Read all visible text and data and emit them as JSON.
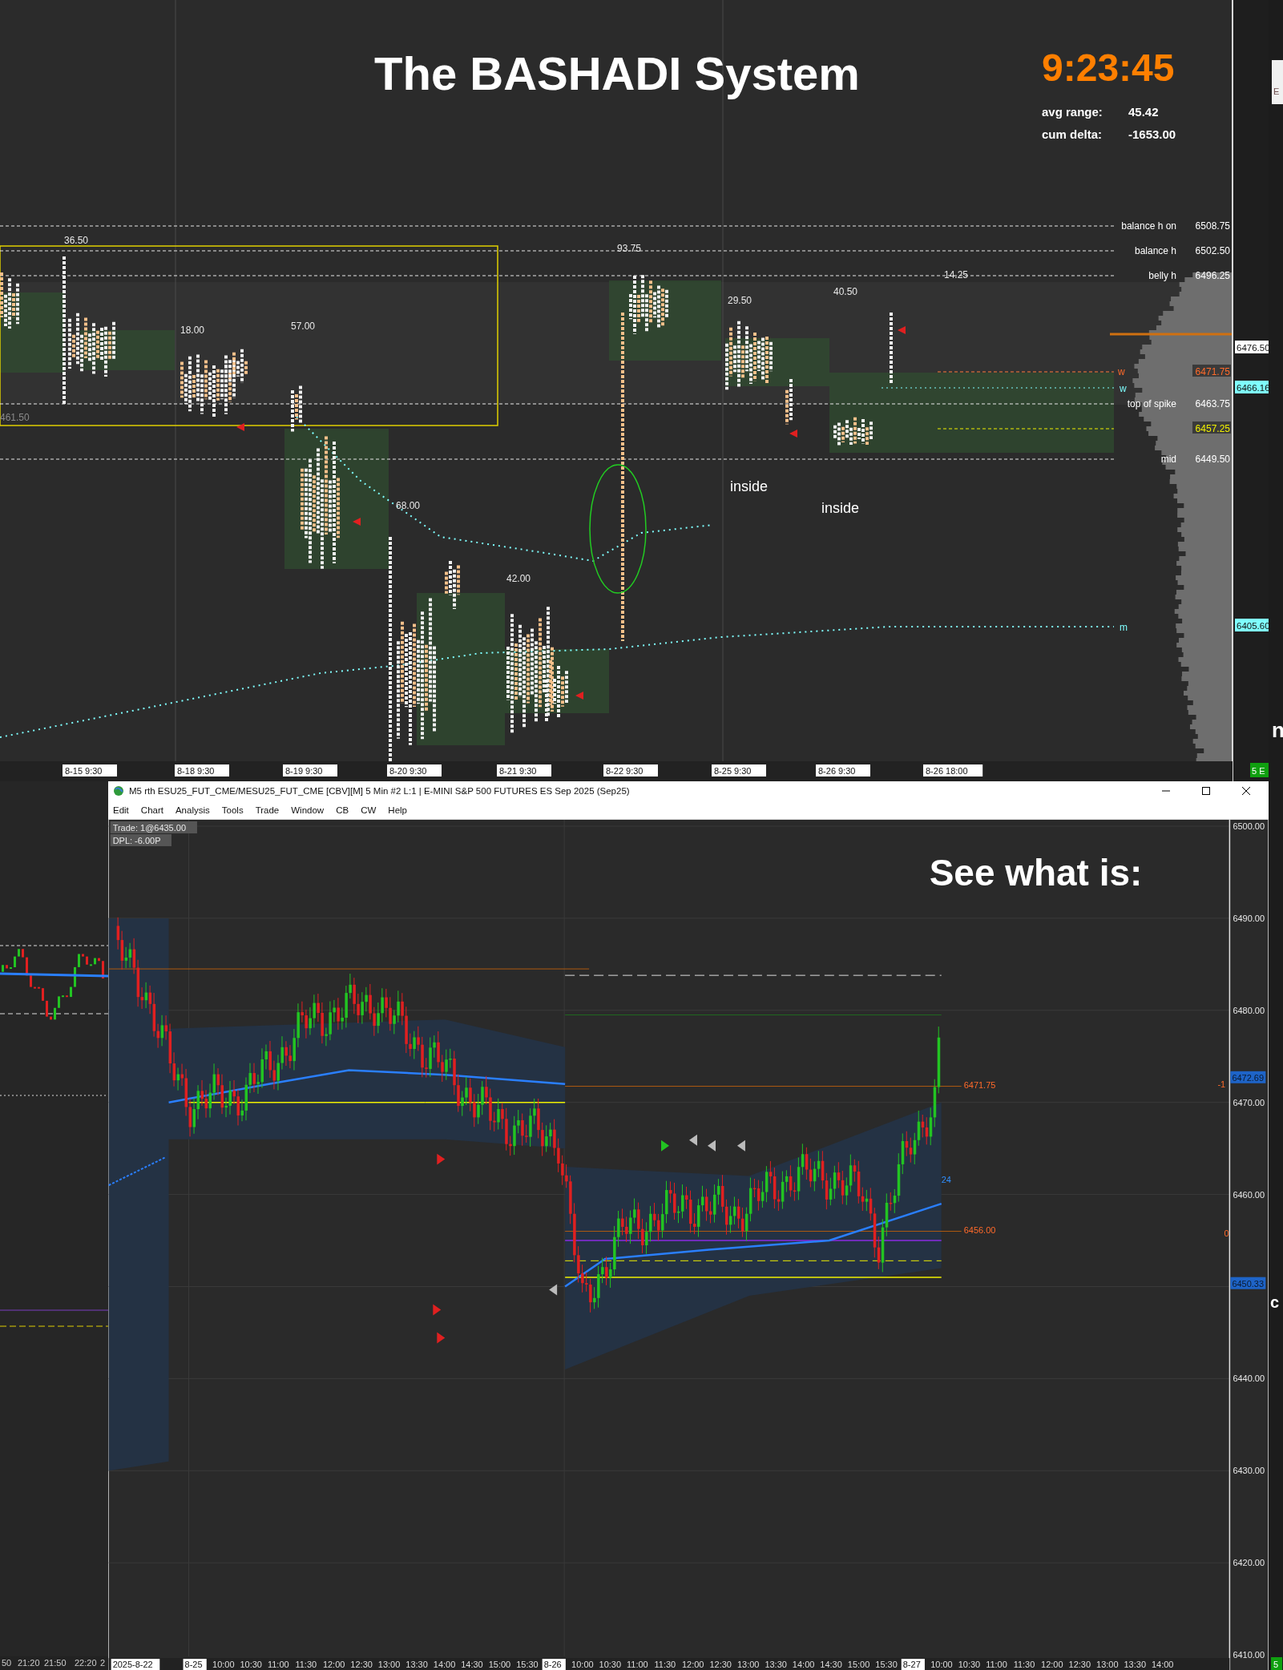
{
  "top_chart": {
    "title": "The BASHADI System",
    "clock": "9:23:45",
    "stats": [
      {
        "label": "avg range:",
        "value": "45.42"
      },
      {
        "label": "cum delta:",
        "value": "-1653.00"
      }
    ],
    "levels": [
      {
        "label": "balance h on",
        "value": "6508.75",
        "kind": "plain"
      },
      {
        "label": "balance h",
        "value": "6502.50",
        "kind": "plain"
      },
      {
        "label": "belly h",
        "value": "6496.25",
        "kind": "plain"
      },
      {
        "value": "6471.75",
        "kind": "orange"
      },
      {
        "label": "top of spike",
        "value": "6463.75",
        "kind": "plain"
      },
      {
        "value": "6457.25",
        "kind": "yellow"
      },
      {
        "label": "mid",
        "value": "6449.50",
        "kind": "plain"
      }
    ],
    "line_markers": [
      {
        "text": "w",
        "kind": "orange"
      },
      {
        "text": "w",
        "kind": "cyan"
      },
      {
        "text": "m",
        "kind": "cyan"
      }
    ],
    "axis_tags": [
      {
        "text": "6476.50",
        "kind": "white"
      },
      {
        "text": "6466.16",
        "kind": "cyan"
      },
      {
        "text": "6405.60",
        "kind": "cyan"
      }
    ],
    "range_labels": [
      "36.50",
      "18.00",
      "57.00",
      "93.75",
      "29.50",
      "40.50",
      "14.25",
      "68.00",
      "42.00",
      "461.50"
    ],
    "notes": [
      "inside",
      "inside"
    ],
    "time_axis": [
      "8-15  9:30",
      "8-18  9:30",
      "8-19  9:30",
      "8-20  9:30",
      "8-21  9:30",
      "8-22  9:30",
      "8-25  9:30",
      "8-26  9:30",
      "8-26  18:00"
    ],
    "badge": "5 E"
  },
  "left_chart": {
    "time_axis": [
      "50",
      "21:20",
      "21:50",
      "22:20",
      "2"
    ]
  },
  "chart_window": {
    "title": "M5 rth ESU25_FUT_CME/MESU25_FUT_CME [CBV][M]  5 Min  #2 L:1 | E-MINI S&P 500 FUTURES ES Sep 2025 (Sep25)",
    "menu": [
      "Edit",
      "Chart",
      "Analysis",
      "Tools",
      "Trade",
      "Window",
      "CB",
      "CW",
      "Help"
    ],
    "info": [
      "Trade: 1@6435.00",
      "DPL: -6.00P"
    ],
    "headline": "See what is:",
    "price_axis": [
      "6500.00",
      "6490.00",
      "6480.00",
      "6470.00",
      "6460.00",
      "6440.00",
      "6430.00",
      "6420.00",
      "6410.00"
    ],
    "price_tags": [
      "6472.69",
      "6450.33"
    ],
    "line_labels": [
      {
        "text": "6471.75",
        "kind": "orange"
      },
      {
        "text": "24",
        "kind": "blue"
      },
      {
        "text": "6456.00",
        "kind": "orange"
      },
      {
        "text": "-1",
        "kind": "orange"
      },
      {
        "text": "0",
        "kind": "orange"
      }
    ],
    "time_axis": [
      {
        "text": "2025-8-22",
        "kind": "date"
      },
      {
        "text": "8-25",
        "kind": "date"
      },
      {
        "text": "10:00",
        "kind": "time"
      },
      {
        "text": "10:30",
        "kind": "time"
      },
      {
        "text": "11:00",
        "kind": "time"
      },
      {
        "text": "11:30",
        "kind": "time"
      },
      {
        "text": "12:00",
        "kind": "time"
      },
      {
        "text": "12:30",
        "kind": "time"
      },
      {
        "text": "13:00",
        "kind": "time"
      },
      {
        "text": "13:30",
        "kind": "time"
      },
      {
        "text": "14:00",
        "kind": "time"
      },
      {
        "text": "14:30",
        "kind": "time"
      },
      {
        "text": "15:00",
        "kind": "time"
      },
      {
        "text": "15:30",
        "kind": "time"
      },
      {
        "text": "8-26",
        "kind": "date"
      },
      {
        "text": "10:00",
        "kind": "time"
      },
      {
        "text": "10:30",
        "kind": "time"
      },
      {
        "text": "11:00",
        "kind": "time"
      },
      {
        "text": "11:30",
        "kind": "time"
      },
      {
        "text": "12:00",
        "kind": "time"
      },
      {
        "text": "12:30",
        "kind": "time"
      },
      {
        "text": "13:00",
        "kind": "time"
      },
      {
        "text": "13:30",
        "kind": "time"
      },
      {
        "text": "14:00",
        "kind": "time"
      },
      {
        "text": "14:30",
        "kind": "time"
      },
      {
        "text": "15:00",
        "kind": "time"
      },
      {
        "text": "15:30",
        "kind": "time"
      },
      {
        "text": "8-27",
        "kind": "date"
      },
      {
        "text": "10:00",
        "kind": "time"
      },
      {
        "text": "10:30",
        "kind": "time"
      },
      {
        "text": "11:00",
        "kind": "time"
      },
      {
        "text": "11:30",
        "kind": "time"
      },
      {
        "text": "12:00",
        "kind": "time"
      },
      {
        "text": "12:30",
        "kind": "time"
      },
      {
        "text": "13:00",
        "kind": "time"
      },
      {
        "text": "13:30",
        "kind": "time"
      },
      {
        "text": "14:00",
        "kind": "time"
      }
    ]
  },
  "edge_fragments": [
    "E",
    "n",
    "c",
    "5"
  ]
}
